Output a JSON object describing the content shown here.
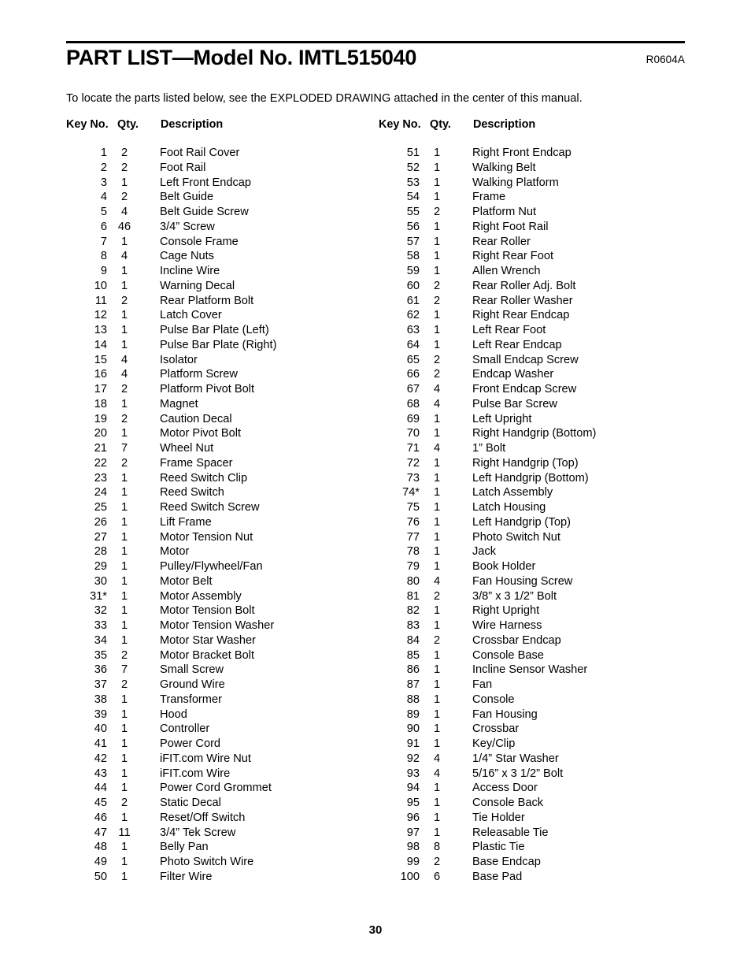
{
  "document": {
    "title": "PART LIST—Model No. IMTL515040",
    "revision": "R0604A",
    "intro": "To locate the parts listed below, see the EXPLODED DRAWING attached in the center of this manual.",
    "page_number": "30"
  },
  "table": {
    "headers": {
      "key_no": "Key No.",
      "qty": "Qty.",
      "description": "Description"
    },
    "left_column": [
      {
        "key": "1",
        "qty": "2",
        "desc": "Foot Rail Cover"
      },
      {
        "key": "2",
        "qty": "2",
        "desc": "Foot Rail"
      },
      {
        "key": "3",
        "qty": "1",
        "desc": "Left Front Endcap"
      },
      {
        "key": "4",
        "qty": "2",
        "desc": "Belt Guide"
      },
      {
        "key": "5",
        "qty": "4",
        "desc": "Belt Guide Screw"
      },
      {
        "key": "6",
        "qty": "46",
        "desc": "3/4” Screw"
      },
      {
        "key": "7",
        "qty": "1",
        "desc": "Console Frame"
      },
      {
        "key": "8",
        "qty": "4",
        "desc": "Cage Nuts"
      },
      {
        "key": "9",
        "qty": "1",
        "desc": "Incline Wire"
      },
      {
        "key": "10",
        "qty": "1",
        "desc": "Warning Decal"
      },
      {
        "key": "11",
        "qty": "2",
        "desc": "Rear Platform Bolt"
      },
      {
        "key": "12",
        "qty": "1",
        "desc": "Latch Cover"
      },
      {
        "key": "13",
        "qty": "1",
        "desc": "Pulse Bar Plate (Left)"
      },
      {
        "key": "14",
        "qty": "1",
        "desc": "Pulse Bar Plate (Right)"
      },
      {
        "key": "15",
        "qty": "4",
        "desc": "Isolator"
      },
      {
        "key": "16",
        "qty": "4",
        "desc": "Platform Screw"
      },
      {
        "key": "17",
        "qty": "2",
        "desc": "Platform Pivot Bolt"
      },
      {
        "key": "18",
        "qty": "1",
        "desc": "Magnet"
      },
      {
        "key": "19",
        "qty": "2",
        "desc": "Caution Decal"
      },
      {
        "key": "20",
        "qty": "1",
        "desc": "Motor Pivot Bolt"
      },
      {
        "key": "21",
        "qty": "7",
        "desc": "Wheel Nut"
      },
      {
        "key": "22",
        "qty": "2",
        "desc": "Frame Spacer"
      },
      {
        "key": "23",
        "qty": "1",
        "desc": "Reed Switch Clip"
      },
      {
        "key": "24",
        "qty": "1",
        "desc": "Reed Switch"
      },
      {
        "key": "25",
        "qty": "1",
        "desc": "Reed Switch Screw"
      },
      {
        "key": "26",
        "qty": "1",
        "desc": "Lift Frame"
      },
      {
        "key": "27",
        "qty": "1",
        "desc": "Motor Tension Nut"
      },
      {
        "key": "28",
        "qty": "1",
        "desc": "Motor"
      },
      {
        "key": "29",
        "qty": "1",
        "desc": "Pulley/Flywheel/Fan"
      },
      {
        "key": "30",
        "qty": "1",
        "desc": "Motor Belt"
      },
      {
        "key": "31*",
        "qty": "1",
        "desc": "Motor Assembly"
      },
      {
        "key": "32",
        "qty": "1",
        "desc": "Motor Tension Bolt"
      },
      {
        "key": "33",
        "qty": "1",
        "desc": "Motor Tension Washer"
      },
      {
        "key": "34",
        "qty": "1",
        "desc": "Motor Star Washer"
      },
      {
        "key": "35",
        "qty": "2",
        "desc": "Motor Bracket Bolt"
      },
      {
        "key": "36",
        "qty": "7",
        "desc": "Small Screw"
      },
      {
        "key": "37",
        "qty": "2",
        "desc": "Ground Wire"
      },
      {
        "key": "38",
        "qty": "1",
        "desc": "Transformer"
      },
      {
        "key": "39",
        "qty": "1",
        "desc": "Hood"
      },
      {
        "key": "40",
        "qty": "1",
        "desc": "Controller"
      },
      {
        "key": "41",
        "qty": "1",
        "desc": "Power Cord"
      },
      {
        "key": "42",
        "qty": "1",
        "desc": "iFIT.com Wire Nut"
      },
      {
        "key": "43",
        "qty": "1",
        "desc": "iFIT.com Wire"
      },
      {
        "key": "44",
        "qty": "1",
        "desc": "Power Cord Grommet"
      },
      {
        "key": "45",
        "qty": "2",
        "desc": "Static Decal"
      },
      {
        "key": "46",
        "qty": "1",
        "desc": "Reset/Off Switch"
      },
      {
        "key": "47",
        "qty": "11",
        "desc": "3/4” Tek Screw"
      },
      {
        "key": "48",
        "qty": "1",
        "desc": "Belly Pan"
      },
      {
        "key": "49",
        "qty": "1",
        "desc": "Photo Switch Wire"
      },
      {
        "key": "50",
        "qty": "1",
        "desc": "Filter Wire"
      }
    ],
    "right_column": [
      {
        "key": "51",
        "qty": "1",
        "desc": "Right Front Endcap"
      },
      {
        "key": "52",
        "qty": "1",
        "desc": "Walking Belt"
      },
      {
        "key": "53",
        "qty": "1",
        "desc": "Walking Platform"
      },
      {
        "key": "54",
        "qty": "1",
        "desc": "Frame"
      },
      {
        "key": "55",
        "qty": "2",
        "desc": "Platform Nut"
      },
      {
        "key": "56",
        "qty": "1",
        "desc": "Right Foot Rail"
      },
      {
        "key": "57",
        "qty": "1",
        "desc": "Rear Roller"
      },
      {
        "key": "58",
        "qty": "1",
        "desc": "Right Rear Foot"
      },
      {
        "key": "59",
        "qty": "1",
        "desc": "Allen Wrench"
      },
      {
        "key": "60",
        "qty": "2",
        "desc": "Rear Roller Adj. Bolt"
      },
      {
        "key": "61",
        "qty": "2",
        "desc": "Rear Roller Washer"
      },
      {
        "key": "62",
        "qty": "1",
        "desc": "Right Rear Endcap"
      },
      {
        "key": "63",
        "qty": "1",
        "desc": "Left Rear Foot"
      },
      {
        "key": "64",
        "qty": "1",
        "desc": "Left Rear Endcap"
      },
      {
        "key": "65",
        "qty": "2",
        "desc": "Small Endcap Screw"
      },
      {
        "key": "66",
        "qty": "2",
        "desc": "Endcap Washer"
      },
      {
        "key": "67",
        "qty": "4",
        "desc": "Front Endcap Screw"
      },
      {
        "key": "68",
        "qty": "4",
        "desc": "Pulse Bar Screw"
      },
      {
        "key": "69",
        "qty": "1",
        "desc": "Left Upright"
      },
      {
        "key": "70",
        "qty": "1",
        "desc": "Right Handgrip (Bottom)"
      },
      {
        "key": "71",
        "qty": "4",
        "desc": "1” Bolt"
      },
      {
        "key": "72",
        "qty": "1",
        "desc": "Right Handgrip (Top)"
      },
      {
        "key": "73",
        "qty": "1",
        "desc": "Left Handgrip (Bottom)"
      },
      {
        "key": "74*",
        "qty": "1",
        "desc": "Latch Assembly"
      },
      {
        "key": "75",
        "qty": "1",
        "desc": "Latch Housing"
      },
      {
        "key": "76",
        "qty": "1",
        "desc": "Left Handgrip (Top)"
      },
      {
        "key": "77",
        "qty": "1",
        "desc": "Photo Switch Nut"
      },
      {
        "key": "78",
        "qty": "1",
        "desc": "Jack"
      },
      {
        "key": "79",
        "qty": "1",
        "desc": "Book Holder"
      },
      {
        "key": "80",
        "qty": "4",
        "desc": "Fan Housing Screw"
      },
      {
        "key": "81",
        "qty": "2",
        "desc": "3/8” x 3 1/2” Bolt"
      },
      {
        "key": "82",
        "qty": "1",
        "desc": "Right Upright"
      },
      {
        "key": "83",
        "qty": "1",
        "desc": "Wire Harness"
      },
      {
        "key": "84",
        "qty": "2",
        "desc": "Crossbar Endcap"
      },
      {
        "key": "85",
        "qty": "1",
        "desc": "Console Base"
      },
      {
        "key": "86",
        "qty": "1",
        "desc": "Incline Sensor Washer"
      },
      {
        "key": "87",
        "qty": "1",
        "desc": "Fan"
      },
      {
        "key": "88",
        "qty": "1",
        "desc": "Console"
      },
      {
        "key": "89",
        "qty": "1",
        "desc": "Fan Housing"
      },
      {
        "key": "90",
        "qty": "1",
        "desc": "Crossbar"
      },
      {
        "key": "91",
        "qty": "1",
        "desc": "Key/Clip"
      },
      {
        "key": "92",
        "qty": "4",
        "desc": "1/4” Star Washer"
      },
      {
        "key": "93",
        "qty": "4",
        "desc": "5/16” x 3 1/2” Bolt"
      },
      {
        "key": "94",
        "qty": "1",
        "desc": "Access Door"
      },
      {
        "key": "95",
        "qty": "1",
        "desc": "Console Back"
      },
      {
        "key": "96",
        "qty": "1",
        "desc": "Tie Holder"
      },
      {
        "key": "97",
        "qty": "1",
        "desc": "Releasable Tie"
      },
      {
        "key": "98",
        "qty": "8",
        "desc": "Plastic Tie"
      },
      {
        "key": "99",
        "qty": "2",
        "desc": "Base Endcap"
      },
      {
        "key": "100",
        "qty": "6",
        "desc": "Base Pad"
      }
    ]
  }
}
